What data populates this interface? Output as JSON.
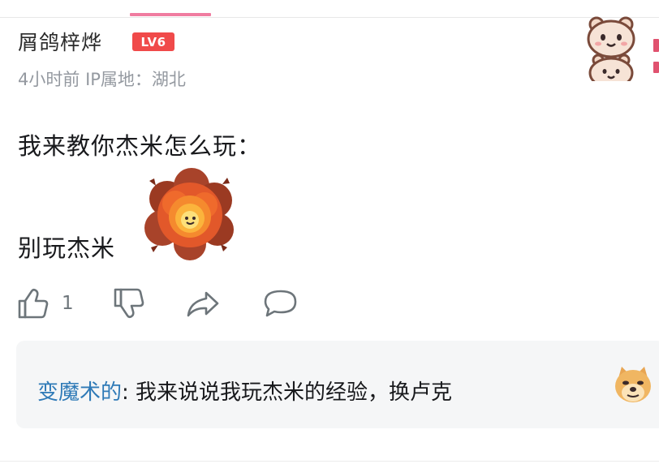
{
  "comment": {
    "username": "屑鸽梓烨",
    "level": "LV6",
    "time": "4小时前",
    "ip_location": "IP属地：湖北",
    "content_line1": "我来教你杰米怎么玩：",
    "content_line2": "别玩杰米",
    "sticker": "explosion-emoji"
  },
  "actions": {
    "like_count": "1",
    "like_icon": "thumbs-up-icon",
    "dislike_icon": "thumbs-down-icon",
    "share_icon": "share-icon",
    "reply_icon": "comment-bubble-icon"
  },
  "reply_preview": {
    "author": "变魔术的",
    "separator": ": ",
    "text": "我来说说我玩杰米的经验，换卢克",
    "emoji": "doge-emoji"
  },
  "colors": {
    "level_badge": "#f04a4a",
    "reply_author": "#2f7ab7",
    "accent": "#f07ca0",
    "meta_text": "#9499a0"
  }
}
